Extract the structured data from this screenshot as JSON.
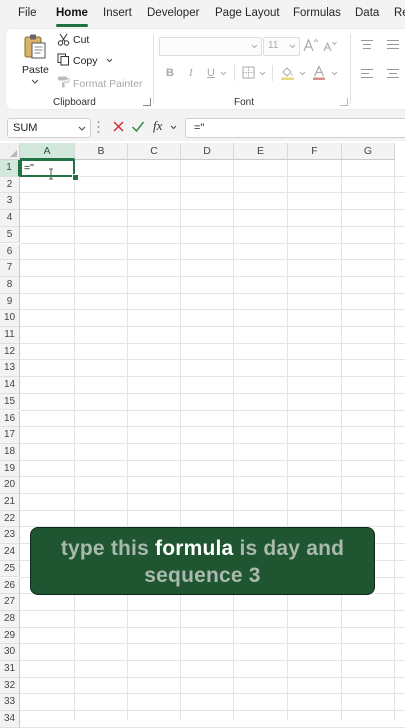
{
  "menu": {
    "items": [
      "File",
      "Home",
      "Insert",
      "Developer",
      "Page Layout",
      "Formulas",
      "Data",
      "Re"
    ],
    "active": "Home"
  },
  "ribbon": {
    "clipboard": {
      "paste": "Paste",
      "cut": "Cut",
      "copy": "Copy",
      "format_painter": "Format Painter",
      "label": "Clipboard"
    },
    "font": {
      "font_name": "",
      "font_size": "11",
      "bold": "B",
      "italic": "I",
      "underline": "U",
      "label": "Font"
    }
  },
  "formula_bar": {
    "name_box": "SUM",
    "fx": "fx",
    "content": "=\""
  },
  "grid": {
    "columns": [
      "A",
      "B",
      "C",
      "D",
      "E",
      "F",
      "G"
    ],
    "rows": [
      "1",
      "2",
      "3",
      "4",
      "5",
      "6",
      "7",
      "8",
      "9",
      "10",
      "11",
      "12",
      "13",
      "14",
      "15",
      "16",
      "17",
      "18",
      "19",
      "20",
      "21",
      "22",
      "23",
      "24",
      "25",
      "26",
      "27",
      "28",
      "29",
      "30",
      "31",
      "32",
      "33",
      "34"
    ],
    "active_cell_value": "=\""
  },
  "caption": {
    "part1": "type this ",
    "highlight": "formula",
    "part2": " is day and sequence 3"
  },
  "colors": {
    "accent": "#217346",
    "caption_bg": "#1f5530"
  }
}
